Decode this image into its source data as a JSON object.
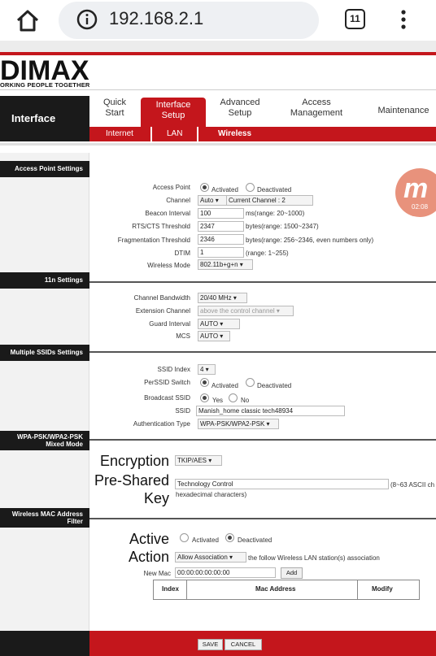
{
  "browser": {
    "url": "192.168.2.1",
    "tab_count": "11"
  },
  "brand": {
    "logo_text": "DIMAX",
    "tagline": "ORKING PEOPLE TOGETHER"
  },
  "nav": {
    "section": "Interface",
    "tabs": [
      {
        "line1": "Quick",
        "line2": "Start"
      },
      {
        "line1": "Interface",
        "line2": "Setup"
      },
      {
        "line1": "Advanced",
        "line2": "Setup"
      },
      {
        "line1": "Access",
        "line2": "Management"
      },
      {
        "line1": "Maintenance",
        "line2": ""
      }
    ],
    "subtabs": [
      "Internet",
      "LAN",
      "Wireless"
    ]
  },
  "sections": {
    "ap": "Access Point Settings",
    "n11": "11n Settings",
    "ssid": "Multiple SSIDs Settings",
    "wpa_line1": "WPA-PSK/WPA2-PSK",
    "wpa_line2": "Mixed Mode",
    "mac_line1": "Wireless MAC Address",
    "mac_line2": "Filter"
  },
  "ap": {
    "access_point_label": "Access Point",
    "activated": "Activated",
    "deactivated": "Deactivated",
    "channel_label": "Channel",
    "channel_value": "Auto",
    "current_channel": "Current Channel : 2",
    "beacon_label": "Beacon Interval",
    "beacon_value": "100",
    "beacon_hint": "ms(range: 20~1000)",
    "rts_label": "RTS/CTS Threshold",
    "rts_value": "2347",
    "rts_hint": "bytes(range: 1500~2347)",
    "frag_label": "Fragmentation Threshold",
    "frag_value": "2346",
    "frag_hint": "bytes(range: 256~2346, even numbers only)",
    "dtim_label": "DTIM",
    "dtim_value": "1",
    "dtim_hint": "(range: 1~255)",
    "mode_label": "Wireless Mode",
    "mode_value": "802.11b+g+n"
  },
  "n11": {
    "bw_label": "Channel Bandwidth",
    "bw_value": "20/40 MHz",
    "ext_label": "Extension Channel",
    "ext_value": "above the control channel",
    "guard_label": "Guard Interval",
    "guard_value": "AUTO",
    "mcs_label": "MCS",
    "mcs_value": "AUTO"
  },
  "ssid": {
    "index_label": "SSID Index",
    "index_value": "4",
    "per_label": "PerSSID Switch",
    "activated": "Activated",
    "deactivated": "Deactivated",
    "broadcast_label": "Broadcast SSID",
    "yes": "Yes",
    "no": "No",
    "ssid_label": "SSID",
    "ssid_value": "Manish_home classic tech48934",
    "auth_label": "Authentication Type",
    "auth_value": "WPA-PSK/WPA2-PSK"
  },
  "wpa": {
    "encryption_label": "Encryption",
    "encryption_value": "TKIP/AES",
    "psk_label_line1": "Pre-Shared",
    "psk_label_line2": "Key",
    "psk_value": "Technology Control",
    "psk_hint": "(8~63 ASCII ch",
    "psk_hint2": "hexadecimal characters)"
  },
  "mac": {
    "active_line1": "Active",
    "active_line2": "Action",
    "activated": "Activated",
    "deactivated": "Deactivated",
    "action_value": "Allow Association",
    "action_hint": "the follow Wireless LAN station(s) association",
    "new_mac_label": "New Mac",
    "new_mac_value": "00:00:00:00:00:00",
    "add_label": "Add",
    "col_index": "Index",
    "col_mac": "Mac Address",
    "col_modify": "Modify"
  },
  "footer": {
    "save": "SAVE",
    "cancel": "CANCEL"
  },
  "overlay": {
    "letter": "m",
    "time": "02:08"
  },
  "colors": {
    "accent_red": "#c4161c",
    "dark": "#1a1a1a"
  }
}
